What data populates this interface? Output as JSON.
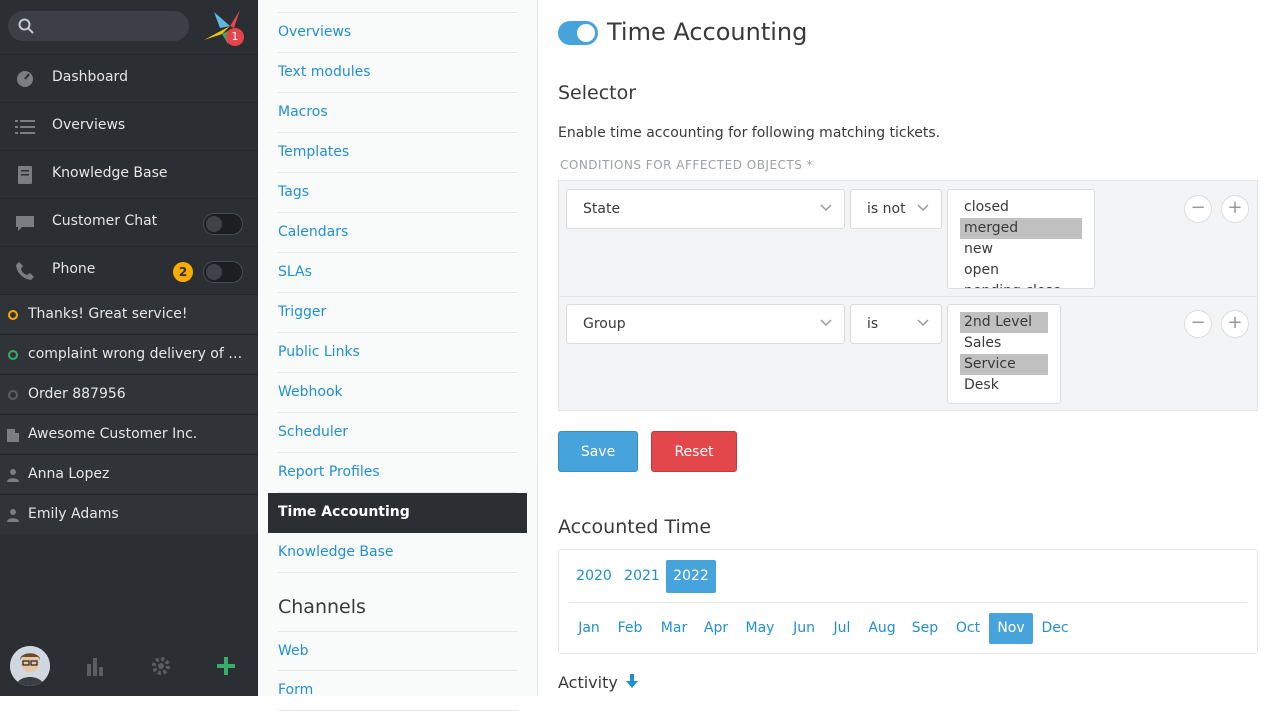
{
  "nav": {
    "logo_badge": "1",
    "items": [
      {
        "label": "Dashboard",
        "icon": "dashboard-icon"
      },
      {
        "label": "Overviews",
        "icon": "list-icon"
      },
      {
        "label": "Knowledge Base",
        "icon": "book-icon"
      },
      {
        "label": "Customer Chat",
        "icon": "chat-icon"
      },
      {
        "label": "Phone",
        "icon": "phone-icon",
        "badge": "2"
      }
    ],
    "tasks": [
      {
        "label": "Thanks! Great service!",
        "status_color": "#faab00"
      },
      {
        "label": "complaint wrong delivery of ord...",
        "status_color": "#38ad69"
      },
      {
        "label": "Order 887956",
        "status_color": "#5a5d62"
      },
      {
        "label": "Awesome Customer Inc.",
        "type": "organization"
      },
      {
        "label": "Anna Lopez",
        "type": "user"
      },
      {
        "label": "Emily Adams",
        "type": "user"
      }
    ]
  },
  "settings": {
    "items": [
      "Overviews",
      "Text modules",
      "Macros",
      "Templates",
      "Tags",
      "Calendars",
      "SLAs",
      "Trigger",
      "Public Links",
      "Webhook",
      "Scheduler",
      "Report Profiles",
      "Time Accounting",
      "Knowledge Base"
    ],
    "active": "Time Accounting",
    "channels_heading": "Channels",
    "channels": [
      "Web",
      "Form"
    ]
  },
  "main": {
    "title": "Time Accounting",
    "selector_heading": "Selector",
    "description": "Enable time accounting for following matching tickets.",
    "conditions_label": "CONDITIONS FOR AFFECTED OBJECTS *",
    "conditions": [
      {
        "attribute": "State",
        "operator": "is not",
        "values": [
          "closed",
          "merged",
          "new",
          "open",
          "pending close"
        ],
        "selected": [
          "merged"
        ]
      },
      {
        "attribute": "Group",
        "operator": "is",
        "values": [
          "2nd Level",
          "Sales",
          "Service Desk"
        ],
        "selected": [
          "2nd Level",
          "Service Desk"
        ]
      }
    ],
    "save_label": "Save",
    "reset_label": "Reset",
    "accounted_heading": "Accounted Time",
    "years": [
      "2020",
      "2021",
      "2022"
    ],
    "active_year": "2022",
    "months": [
      "Jan",
      "Feb",
      "Mar",
      "Apr",
      "May",
      "Jun",
      "Jul",
      "Aug",
      "Sep",
      "Oct",
      "Nov",
      "Dec"
    ],
    "active_month": "Nov",
    "activity_label": "Activity"
  },
  "colors": {
    "accent": "#47a3dc",
    "danger": "#e3474c",
    "nav_bg": "#2b2e33",
    "link": "#2190d1"
  }
}
